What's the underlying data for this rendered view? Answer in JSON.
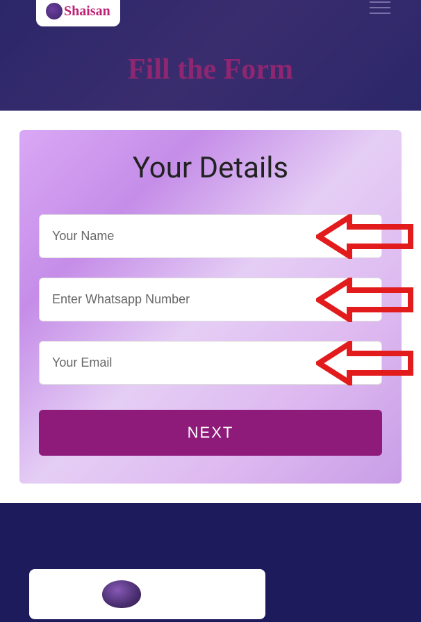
{
  "header": {
    "logo_text": "Shaisan",
    "page_title": "Fill the Form"
  },
  "form": {
    "heading": "Your Details",
    "fields": {
      "name": {
        "placeholder": "Your Name",
        "value": ""
      },
      "whatsapp": {
        "placeholder": "Enter Whatsapp Number",
        "value": ""
      },
      "email": {
        "placeholder": "Your Email",
        "value": ""
      }
    },
    "submit_label": "NEXT"
  },
  "colors": {
    "accent": "#8e1a7a",
    "header_bg": "#2b2769",
    "footer_bg": "#1e1b5c",
    "arrow": "#e21c1c"
  }
}
